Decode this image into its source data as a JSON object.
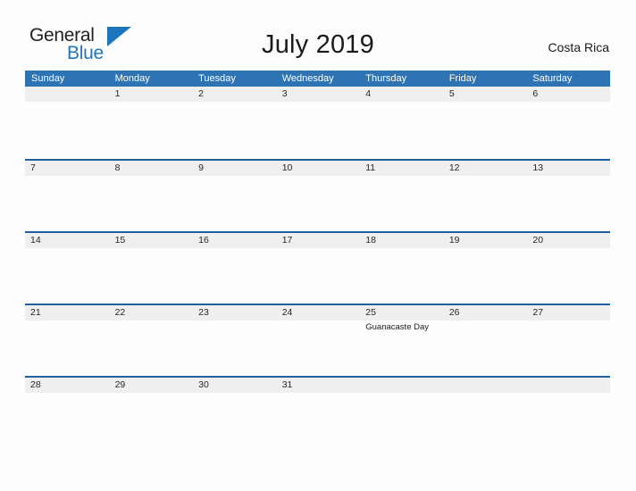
{
  "brand": {
    "name_part1": "General",
    "name_part2": "Blue",
    "triangle_icon": "triangle-icon",
    "color_dark": "#231f20",
    "color_blue": "#2175bc"
  },
  "header": {
    "title": "July 2019",
    "locale": "Costa Rica"
  },
  "calendar": {
    "month": "July",
    "year": "2019",
    "country": "Costa Rica",
    "header_color": "#2e74b5",
    "band_color": "#efefef",
    "rule_color": "#1f5f9e",
    "weekdays": [
      "Sunday",
      "Monday",
      "Tuesday",
      "Wednesday",
      "Thursday",
      "Friday",
      "Saturday"
    ],
    "weeks": [
      {
        "days": [
          {
            "number": "",
            "events": []
          },
          {
            "number": "1",
            "events": []
          },
          {
            "number": "2",
            "events": []
          },
          {
            "number": "3",
            "events": []
          },
          {
            "number": "4",
            "events": []
          },
          {
            "number": "5",
            "events": []
          },
          {
            "number": "6",
            "events": []
          }
        ]
      },
      {
        "days": [
          {
            "number": "7",
            "events": []
          },
          {
            "number": "8",
            "events": []
          },
          {
            "number": "9",
            "events": []
          },
          {
            "number": "10",
            "events": []
          },
          {
            "number": "11",
            "events": []
          },
          {
            "number": "12",
            "events": []
          },
          {
            "number": "13",
            "events": []
          }
        ]
      },
      {
        "days": [
          {
            "number": "14",
            "events": []
          },
          {
            "number": "15",
            "events": []
          },
          {
            "number": "16",
            "events": []
          },
          {
            "number": "17",
            "events": []
          },
          {
            "number": "18",
            "events": []
          },
          {
            "number": "19",
            "events": []
          },
          {
            "number": "20",
            "events": []
          }
        ]
      },
      {
        "days": [
          {
            "number": "21",
            "events": []
          },
          {
            "number": "22",
            "events": []
          },
          {
            "number": "23",
            "events": []
          },
          {
            "number": "24",
            "events": []
          },
          {
            "number": "25",
            "events": [
              "Guanacaste Day"
            ]
          },
          {
            "number": "26",
            "events": []
          },
          {
            "number": "27",
            "events": []
          }
        ]
      },
      {
        "days": [
          {
            "number": "28",
            "events": []
          },
          {
            "number": "29",
            "events": []
          },
          {
            "number": "30",
            "events": []
          },
          {
            "number": "31",
            "events": []
          },
          {
            "number": "",
            "events": []
          },
          {
            "number": "",
            "events": []
          },
          {
            "number": "",
            "events": []
          }
        ]
      }
    ]
  }
}
